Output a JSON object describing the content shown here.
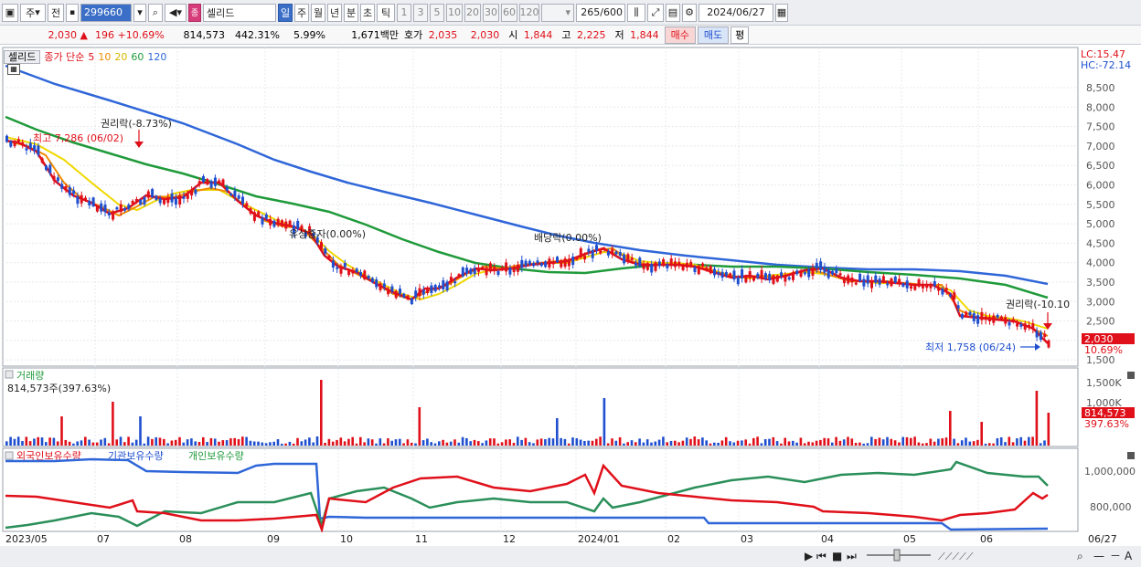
{
  "toolbar": {
    "market": "주",
    "all": "전",
    "code": "299660",
    "badge": "종",
    "name": "셀리드",
    "periods": [
      "일",
      "주",
      "월",
      "년",
      "분",
      "초",
      "틱"
    ],
    "active_period": "일",
    "minutes": [
      "1",
      "3",
      "5",
      "10",
      "20",
      "30",
      "60",
      "120"
    ],
    "count": "265",
    "total": "/600",
    "date": "2024/06/27"
  },
  "quote": {
    "price": "2,030 ▲",
    "change": "196 +10.69%",
    "volume": "814,573",
    "volume_ratio": "442.31%",
    "turnover": "5.99%",
    "amount": "1,671백만",
    "ask_label": "호가",
    "ask": "2,035",
    "bid": "2,030",
    "open_label": "시",
    "open": "1,844",
    "high_label": "고",
    "high": "2,225",
    "low_label": "저",
    "low": "1,844",
    "buy": "매수",
    "sell": "매도",
    "eval": "평"
  },
  "legend": {
    "tab": "셀리드",
    "price_label": "종가 단순",
    "ma": [
      {
        "label": "5",
        "color": "#e0101a"
      },
      {
        "label": "10",
        "color": "#f08a00"
      },
      {
        "label": "20",
        "color": "#e8d000"
      },
      {
        "label": "60",
        "color": "#1f9a3a"
      },
      {
        "label": "120",
        "color": "#2f66d8"
      }
    ]
  },
  "price_axis": {
    "ticks": [
      "8,500",
      "8,000",
      "7,500",
      "7,000",
      "6,500",
      "6,000",
      "5,500",
      "5,000",
      "4,500",
      "4,000",
      "3,500",
      "3,000",
      "2,500",
      "2,000",
      "1,500"
    ],
    "lc": "LC:15.47",
    "hc": "HC:-72.14",
    "current": "2,030",
    "current_pct": "10.69%"
  },
  "annotations": {
    "high": "최고 7,286 (06/02)",
    "rights1": "권리락(-8.73%)",
    "paid_in": "유상증자(0.00%)",
    "dividend": "배당락(0.00%)",
    "rights2": "권리락(-10.10",
    "low": "최저 1,758 (06/24)"
  },
  "volume_panel": {
    "title": "거래량",
    "value": "814,573주(397.63%)",
    "ticks": [
      "1,500K",
      "1,000K"
    ],
    "current": "814,573",
    "current_pct": "397.63%"
  },
  "holdings_panel": {
    "foreign": "외국인보유수량",
    "inst": "기관보유수량",
    "individual": "개인보유수량",
    "ticks": [
      "1,000,000",
      "800,000"
    ]
  },
  "date_axis": [
    "2023/05",
    "07",
    "08",
    "09",
    "10",
    "11",
    "12",
    "2024/01",
    "02",
    "03",
    "04",
    "05",
    "06",
    "06/27"
  ]
}
